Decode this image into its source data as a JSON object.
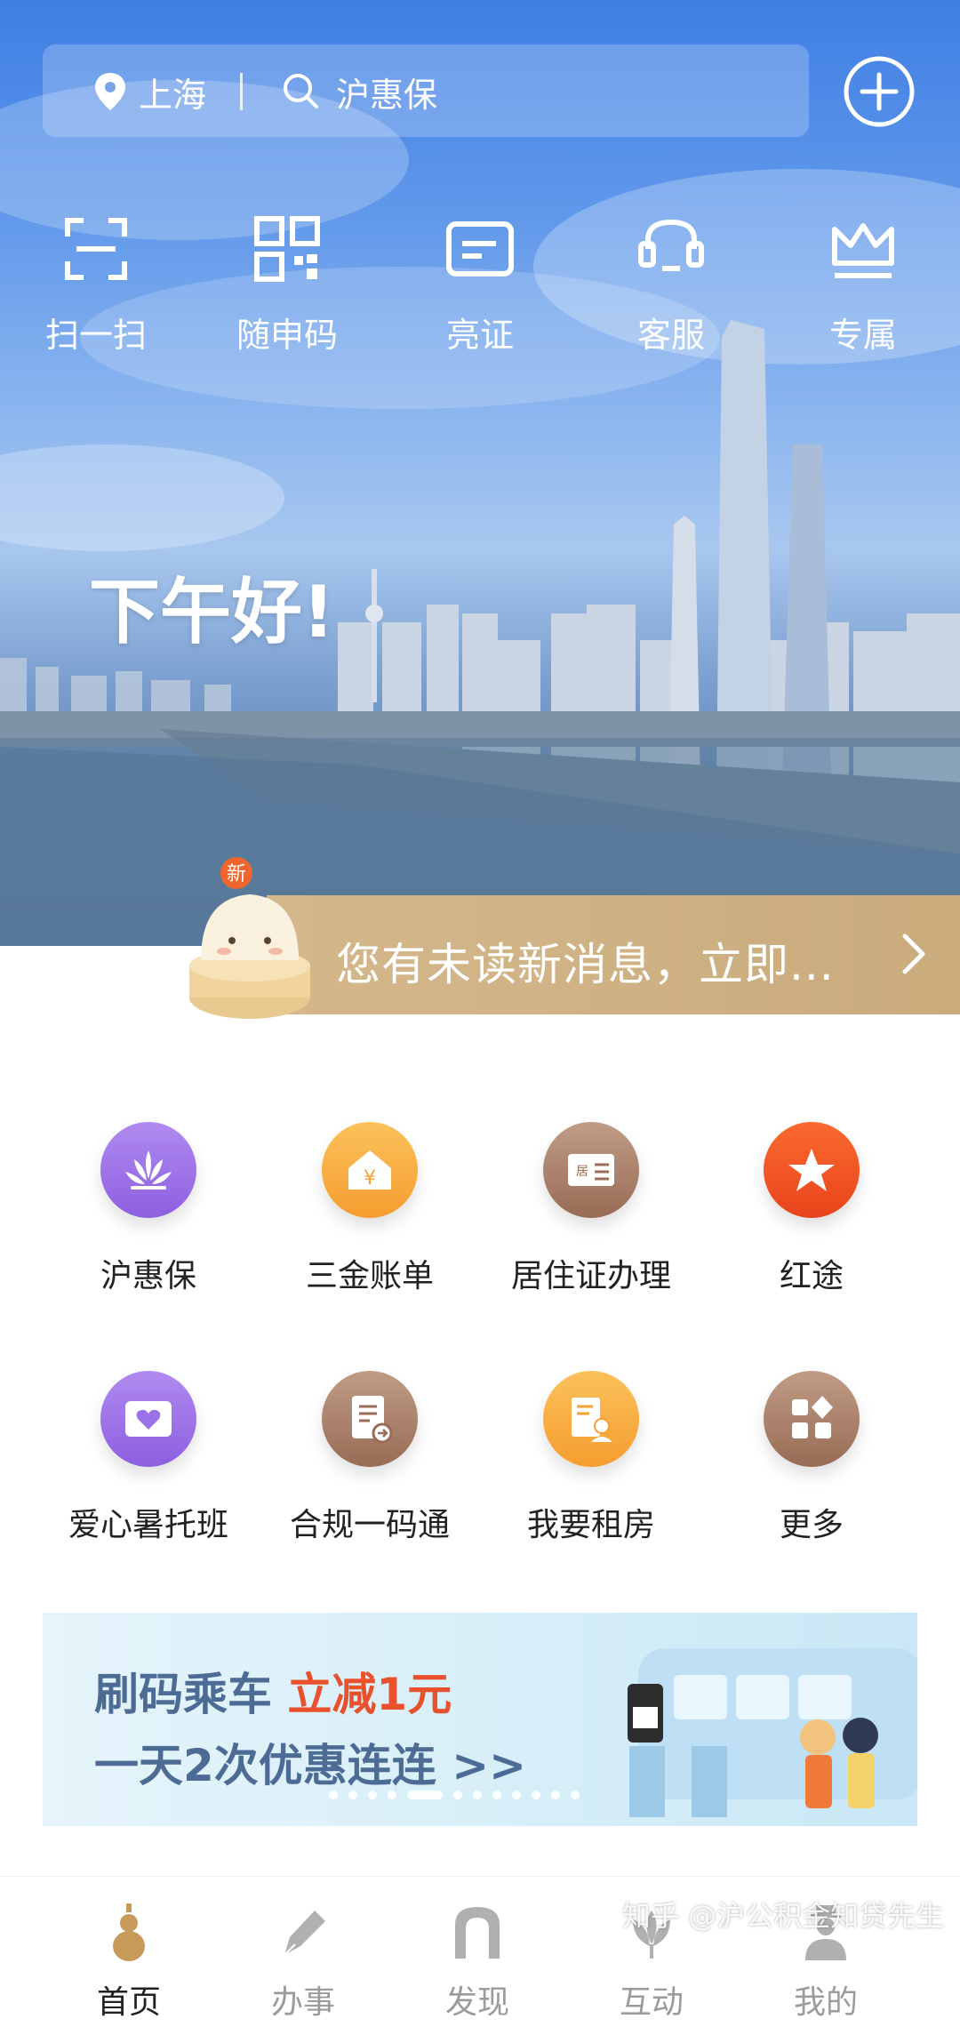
{
  "header": {
    "location": "上海",
    "search_text": "沪惠保"
  },
  "quick_actions": [
    {
      "label": "扫一扫",
      "icon": "scan-icon"
    },
    {
      "label": "随申码",
      "icon": "qr-code-icon"
    },
    {
      "label": "亮证",
      "icon": "id-card-icon"
    },
    {
      "label": "客服",
      "icon": "headset-icon"
    },
    {
      "label": "专属",
      "icon": "crown-icon"
    }
  ],
  "greeting": "下午好!",
  "notice": {
    "badge": "新",
    "text": "您有未读新消息，立即..."
  },
  "services": [
    {
      "label": "沪惠保",
      "icon": "lotus-icon",
      "color": "#9b72e8"
    },
    {
      "label": "三金账单",
      "icon": "house-yen-icon",
      "color": "#f7a73a"
    },
    {
      "label": "居住证办理",
      "icon": "residence-card-icon",
      "color": "#a97d68"
    },
    {
      "label": "红途",
      "icon": "red-star-icon",
      "color": "#f05323"
    },
    {
      "label": "爱心暑托班",
      "icon": "heart-card-icon",
      "color": "#9b72e8"
    },
    {
      "label": "合规一码通",
      "icon": "document-arrow-icon",
      "color": "#a97d68"
    },
    {
      "label": "我要租房",
      "icon": "rent-house-icon",
      "color": "#f7a73a"
    },
    {
      "label": "更多",
      "icon": "grid-more-icon",
      "color": "#a97d68"
    }
  ],
  "banner": {
    "line1": "刷码乘车 ",
    "line1_highlight": "立减1元",
    "line2": "一天2次优惠连连 >>"
  },
  "tabs": [
    {
      "label": "首页",
      "icon": "gourd-icon",
      "active": true
    },
    {
      "label": "办事",
      "icon": "pen-icon",
      "active": false
    },
    {
      "label": "发现",
      "icon": "arch-icon",
      "active": false
    },
    {
      "label": "互动",
      "icon": "magnolia-icon",
      "active": false
    },
    {
      "label": "我的",
      "icon": "person-icon",
      "active": false
    }
  ],
  "watermark": "知乎 @沪公积金知贷先生"
}
